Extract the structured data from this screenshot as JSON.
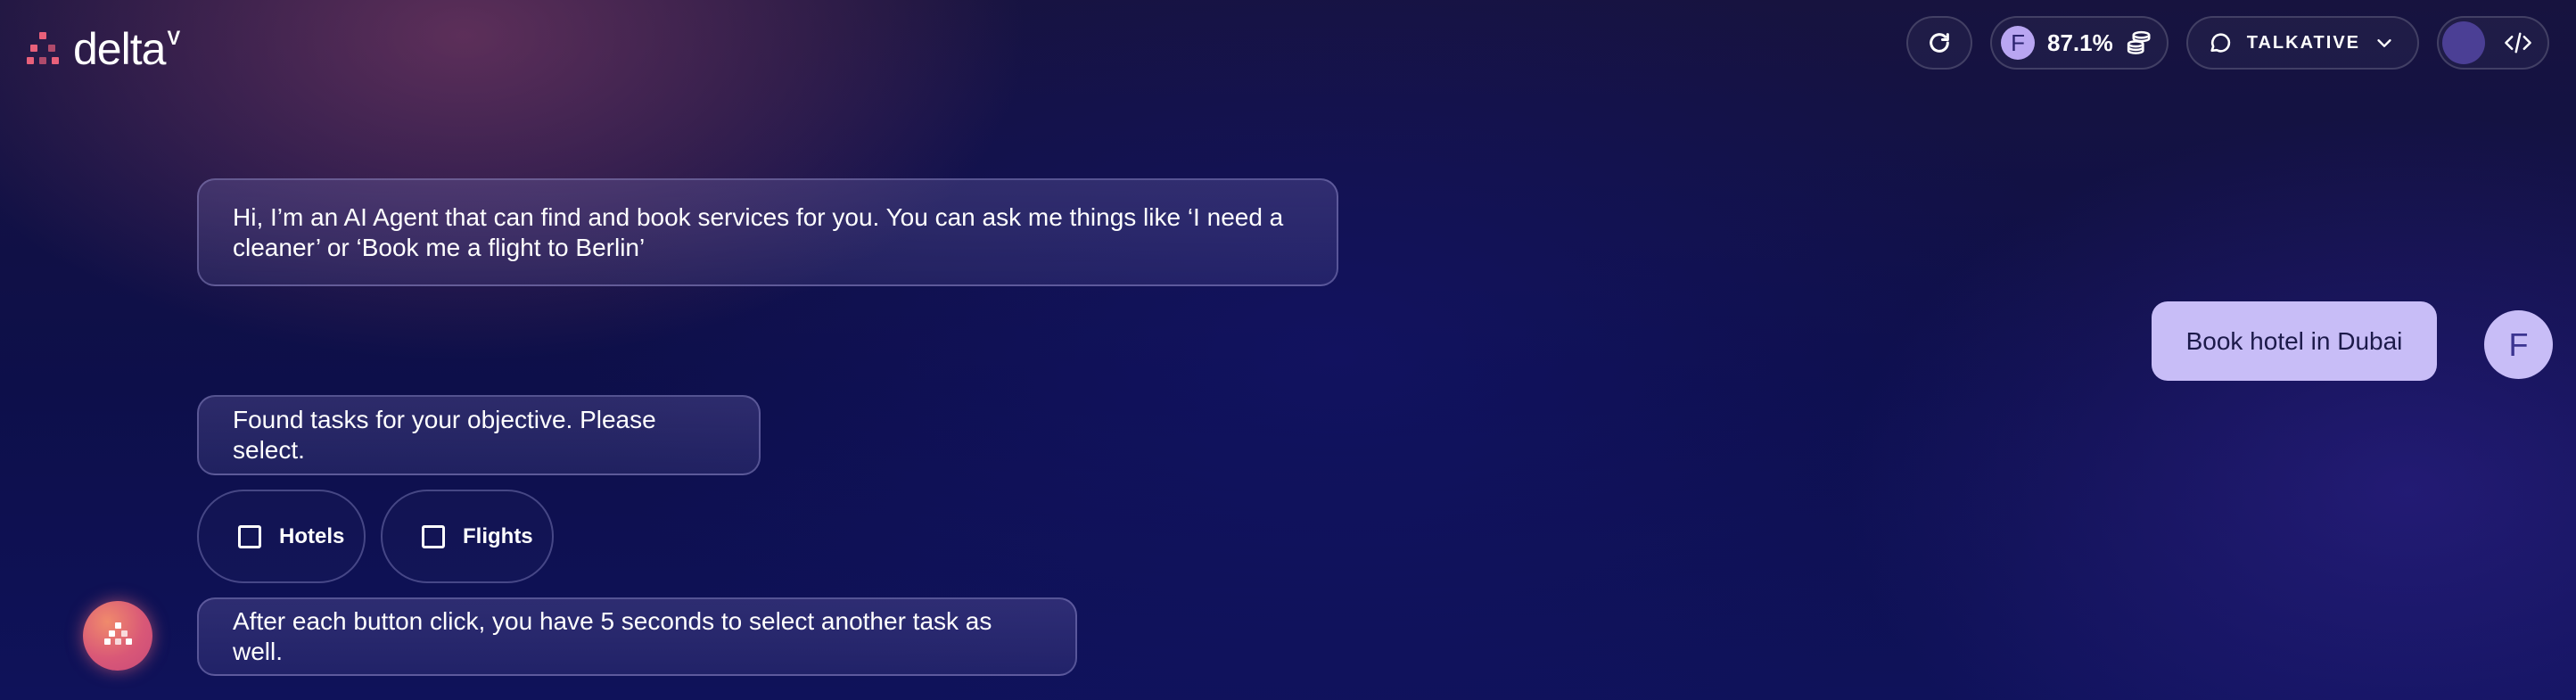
{
  "brand": {
    "name": "delta",
    "superscript": "V",
    "accent_color": "#e8607a"
  },
  "header": {
    "refresh_icon": "refresh-icon",
    "credits": {
      "avatar_initial": "F",
      "percentage": "87.1%",
      "icon": "coin-stack-icon"
    },
    "mode": {
      "icon": "chat-bubble-icon",
      "label": "TALKATIVE",
      "chevron": "chevron-down-icon"
    },
    "dev_toggle_icon": "code-icon"
  },
  "chat": {
    "agent_intro": "Hi, I’m an AI Agent that can find and book services for you. You can ask me things like ‘I need a cleaner’ or ‘Book me a flight to Berlin’",
    "user_message": "Book hotel in Dubai",
    "user_avatar_initial": "F",
    "tasks_prompt": "Found tasks for your objective. Please select.",
    "tasks": [
      {
        "label": "Hotels",
        "checked": false
      },
      {
        "label": "Flights",
        "checked": false
      }
    ],
    "after_click_note": "After each button click, you have 5 seconds to select another task as well."
  },
  "colors": {
    "user_bubble": "#c8bdf7",
    "fab_gradient_start": "#f08a6c",
    "fab_gradient_end": "#c94a7a"
  }
}
